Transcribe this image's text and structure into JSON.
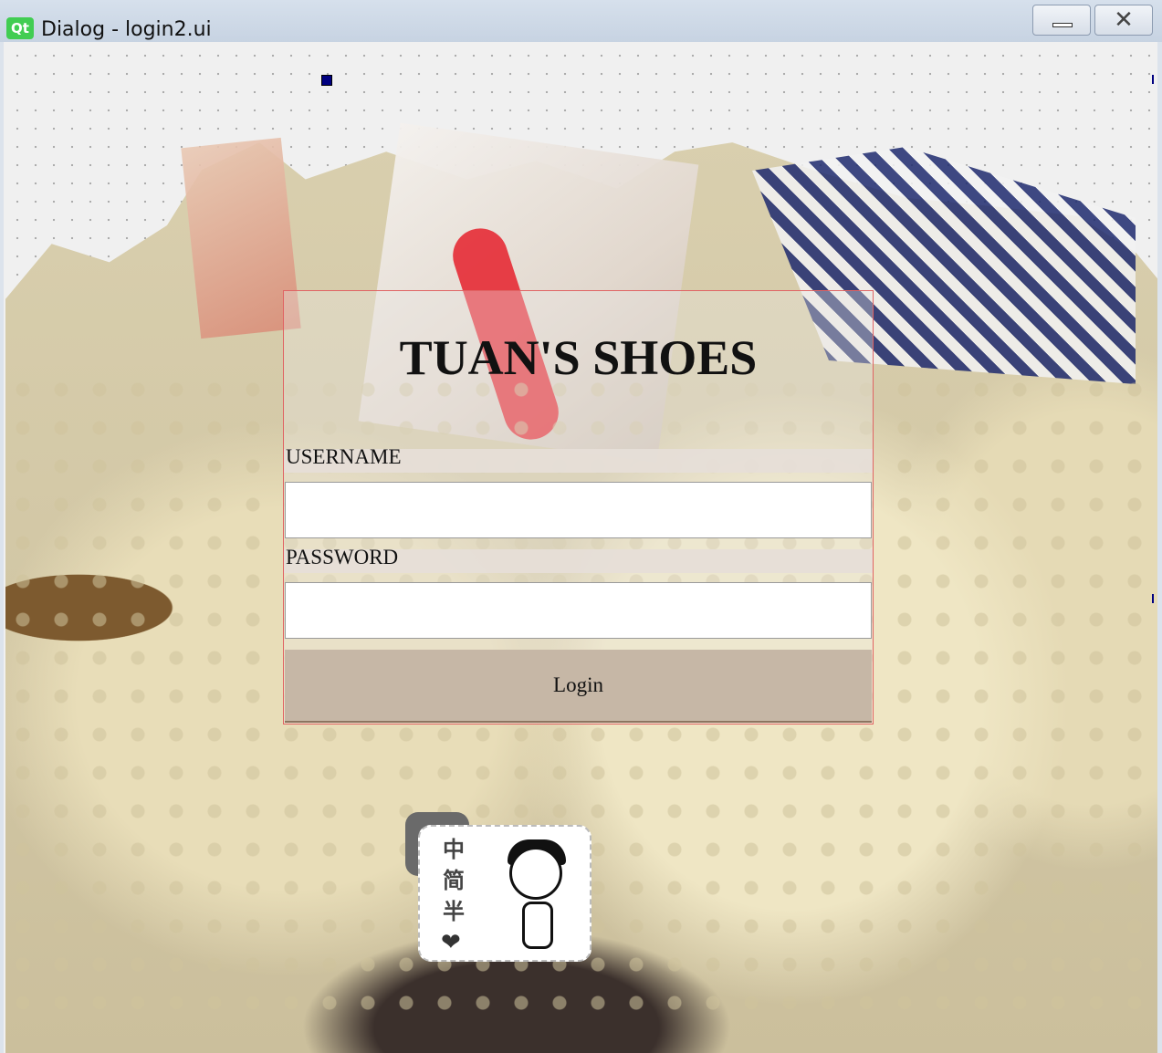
{
  "window": {
    "icon_text": "Qt",
    "title": "Dialog - login2.ui",
    "minimize_glyph": "▭",
    "close_glyph": "✕"
  },
  "login": {
    "brand": "TUAN'S SHOES",
    "username_label": "USERNAME",
    "username_value": "",
    "password_label": "PASSWORD",
    "password_value": "",
    "login_button": "Login"
  },
  "sticker": {
    "chars": [
      "中",
      "简",
      "半"
    ],
    "heart": "❤"
  },
  "colors": {
    "panel_border": "#e06464",
    "button_bg": "#c6b7a6",
    "label_bg": "#e6ded8",
    "qt_green": "#41cd52"
  }
}
